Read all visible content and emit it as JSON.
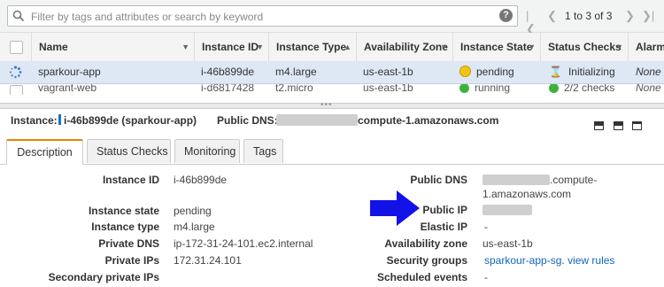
{
  "search": {
    "placeholder": "Filter by tags and attributes or search by keyword"
  },
  "pager": {
    "text": "1 to 3 of 3"
  },
  "table": {
    "columns": [
      "Name",
      "Instance ID",
      "Instance Type",
      "Availability Zone",
      "Instance State",
      "Status Checks",
      "Alarm"
    ],
    "rows": [
      {
        "name": "sparkour-app",
        "id": "i-46b899de",
        "type": "m4.large",
        "az": "us-east-1b",
        "state": "pending",
        "state_color": "#f0c419",
        "checks": "Initializing",
        "alarm": "None"
      },
      {
        "name": "vagrant-web",
        "id": "i-d6817428",
        "type": "t2.micro",
        "az": "us-east-1b",
        "state": "running",
        "state_color": "#3bb33b",
        "checks": "2/2 checks",
        "alarm": "None"
      }
    ]
  },
  "details": {
    "instance_label": "Instance:",
    "instance_value": "i-46b899de (sparkour-app)",
    "dns_label": "Public DNS:",
    "dns_value": "compute-1.amazonaws.com"
  },
  "tabs": [
    "Description",
    "Status Checks",
    "Monitoring",
    "Tags"
  ],
  "description": {
    "left": [
      {
        "label": "Instance ID",
        "value": "i-46b899de"
      },
      {
        "label": "Instance state",
        "value": "pending"
      },
      {
        "label": "Instance type",
        "value": "m4.large"
      },
      {
        "label": "Private DNS",
        "value": "ip-172-31-24-101.ec2.internal"
      },
      {
        "label": "Private IPs",
        "value": "172.31.24.101"
      },
      {
        "label": "Secondary private IPs",
        "value": ""
      }
    ],
    "right": {
      "public_dns_label": "Public DNS",
      "public_dns_line1": ".compute-",
      "public_dns_line2": "1.amazonaws.com",
      "public_ip_label": "Public IP",
      "elastic_ip_label": "Elastic IP",
      "elastic_ip_value": "-",
      "az_label": "Availability zone",
      "az_value": "us-east-1b",
      "sg_label": "Security groups",
      "sg_value": "sparkour-app-sg",
      "sg_sep": ".",
      "sg_link": "view rules",
      "events_label": "Scheduled events",
      "events_value": "-"
    }
  },
  "colors": {
    "accent": "#e98400",
    "link": "#1166bb",
    "arrow": "#1212e8",
    "selected_row": "#dde8f4"
  }
}
